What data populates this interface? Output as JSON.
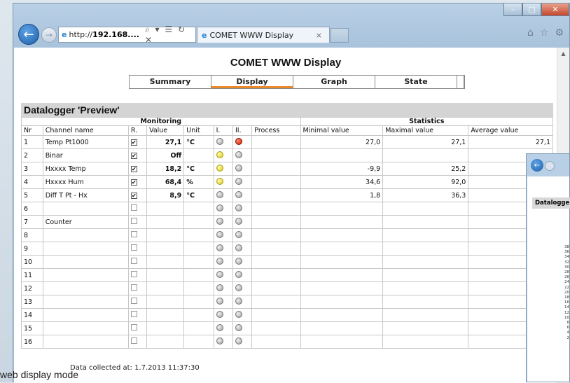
{
  "browser": {
    "url_prefix": "http://",
    "url_host": "192.168....",
    "addr_tools": "⌕ ▾ ☰ ↻ ✕",
    "tab_title": "COMET WWW Display",
    "tab_close": "×"
  },
  "page": {
    "title": "COMET WWW Display",
    "menu": [
      "Summary",
      "Display",
      "Graph",
      "State"
    ],
    "active_menu": "Display",
    "datalogger_title": "Datalogger 'Preview'",
    "group_headers": {
      "monitoring": "Monitoring",
      "statistics": "Statistics"
    },
    "columns": [
      "Nr",
      "Channel name",
      "R.",
      "Value",
      "Unit",
      "I.",
      "II.",
      "Process",
      "Minimal value",
      "Maximal value",
      "Average value"
    ],
    "rows": [
      {
        "nr": "1",
        "name": "Temp Pt1000",
        "checked": true,
        "value": "27,1",
        "unit": "°C",
        "led1": "gray",
        "led2": "red",
        "min": "27,0",
        "max": "27,1",
        "avg": "27,1"
      },
      {
        "nr": "2",
        "name": "Binar",
        "checked": true,
        "value": "Off",
        "unit": "",
        "led1": "yellow",
        "led2": "gray",
        "min": "",
        "max": "",
        "avg": ""
      },
      {
        "nr": "3",
        "name": "Hxxxx Temp",
        "checked": true,
        "value": "18,2",
        "unit": "°C",
        "led1": "yellow",
        "led2": "gray",
        "min": "-9,9",
        "max": "25,2",
        "avg": ""
      },
      {
        "nr": "4",
        "name": "Hxxxx Hum",
        "checked": true,
        "value": "68,4",
        "unit": "%",
        "led1": "yellow",
        "led2": "gray",
        "min": "34,6",
        "max": "92,0",
        "avg": ""
      },
      {
        "nr": "5",
        "name": "Diff T Pt - Hx",
        "checked": true,
        "value": "8,9",
        "unit": "°C",
        "led1": "gray",
        "led2": "gray",
        "min": "1,8",
        "max": "36,3",
        "avg": ""
      },
      {
        "nr": "6",
        "name": "",
        "checked": false,
        "value": "",
        "unit": "",
        "led1": "gray",
        "led2": "gray",
        "min": "",
        "max": "",
        "avg": ""
      },
      {
        "nr": "7",
        "name": "Counter",
        "checked": false,
        "value": "",
        "unit": "",
        "led1": "gray",
        "led2": "gray",
        "min": "",
        "max": "",
        "avg": ""
      },
      {
        "nr": "8",
        "name": "",
        "checked": false,
        "value": "",
        "unit": "",
        "led1": "gray",
        "led2": "gray",
        "min": "",
        "max": "",
        "avg": ""
      },
      {
        "nr": "9",
        "name": "",
        "checked": false,
        "value": "",
        "unit": "",
        "led1": "gray",
        "led2": "gray",
        "min": "",
        "max": "",
        "avg": ""
      },
      {
        "nr": "10",
        "name": "",
        "checked": false,
        "value": "",
        "unit": "",
        "led1": "gray",
        "led2": "gray",
        "min": "",
        "max": "",
        "avg": ""
      },
      {
        "nr": "11",
        "name": "",
        "checked": false,
        "value": "",
        "unit": "",
        "led1": "gray",
        "led2": "gray",
        "min": "",
        "max": "",
        "avg": ""
      },
      {
        "nr": "12",
        "name": "",
        "checked": false,
        "value": "",
        "unit": "",
        "led1": "gray",
        "led2": "gray",
        "min": "",
        "max": "",
        "avg": ""
      },
      {
        "nr": "13",
        "name": "",
        "checked": false,
        "value": "",
        "unit": "",
        "led1": "gray",
        "led2": "gray",
        "min": "",
        "max": "",
        "avg": ""
      },
      {
        "nr": "14",
        "name": "",
        "checked": false,
        "value": "",
        "unit": "",
        "led1": "gray",
        "led2": "gray",
        "min": "",
        "max": "",
        "avg": ""
      },
      {
        "nr": "15",
        "name": "",
        "checked": false,
        "value": "",
        "unit": "",
        "led1": "gray",
        "led2": "gray",
        "min": "",
        "max": "",
        "avg": ""
      },
      {
        "nr": "16",
        "name": "",
        "checked": false,
        "value": "",
        "unit": "",
        "led1": "gray",
        "led2": "gray",
        "min": "",
        "max": "",
        "avg": ""
      }
    ],
    "footer": "Data collected at: 1.7.2013 11:37:30"
  },
  "second_window": {
    "datalogger_title": "Datalogge",
    "axis_ticks": [
      "38",
      "36",
      "34",
      "32",
      "30",
      "28",
      "26",
      "24",
      "22",
      "20",
      "18",
      "16",
      "14",
      "12",
      "10",
      "8",
      "6",
      "4",
      "2"
    ]
  },
  "caption": "web display mode",
  "colors": {
    "active_tab_accent": "#e8892b",
    "section_header_bg": "#d4d4d4",
    "led_red": "#cc1a00",
    "led_yellow": "#d8cb12"
  },
  "icons": [
    "back-arrow-icon",
    "forward-arrow-icon",
    "ie-logo-icon",
    "home-icon",
    "favorites-star-icon",
    "settings-gear-icon",
    "checkbox-icon",
    "status-led-icon"
  ]
}
